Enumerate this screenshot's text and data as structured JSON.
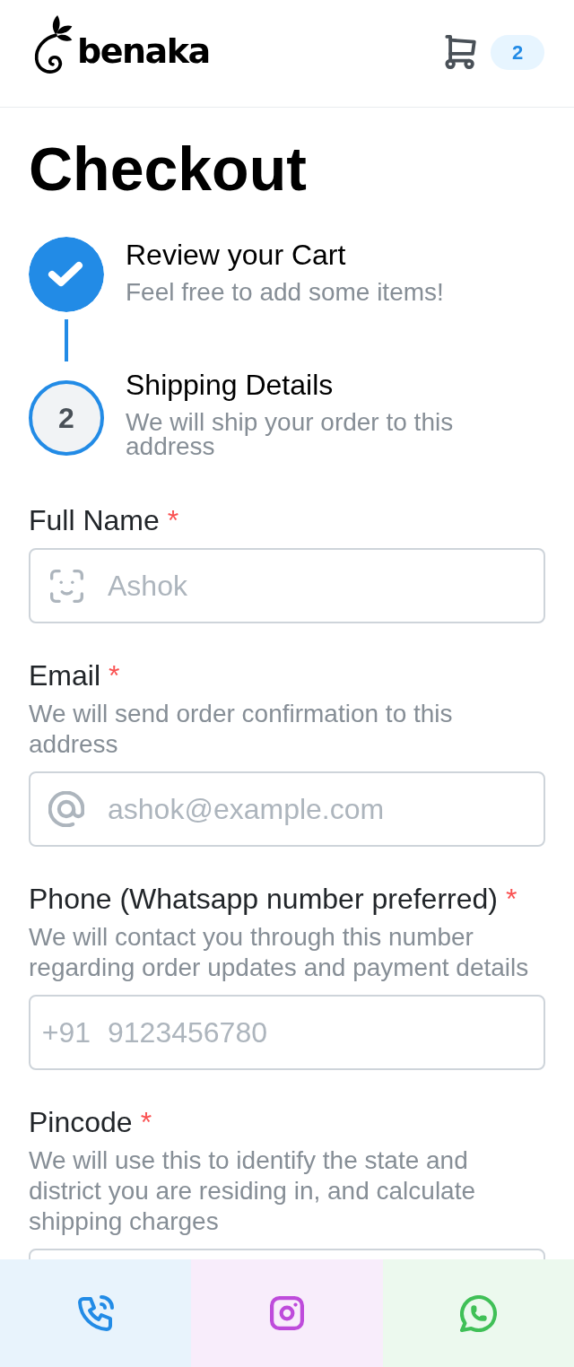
{
  "header": {
    "logo_text": "benaka",
    "cart_count": "2"
  },
  "page_title": "Checkout",
  "stepper": {
    "steps": [
      {
        "title": "Review your Cart",
        "description": "Feel free to add some items!",
        "completed": true,
        "active": false
      },
      {
        "number": "2",
        "title": "Shipping Details",
        "description": "We will ship your order to this address",
        "completed": false,
        "active": true
      }
    ]
  },
  "form": {
    "fields": [
      {
        "kind": "name",
        "label": "Full Name",
        "required_mark": "*",
        "placeholder": "Ashok"
      },
      {
        "kind": "email",
        "label": "Email",
        "required_mark": "*",
        "description": "We will send order confirmation to this address",
        "placeholder": "ashok@example.com"
      },
      {
        "kind": "phone",
        "label": "Phone (Whatsapp number preferred)",
        "required_mark": "*",
        "description": "We will contact you through this number regarding order updates and payment details",
        "prefix": "+91",
        "placeholder": "9123456780"
      },
      {
        "kind": "pincode",
        "label": "Pincode",
        "required_mark": "*",
        "description": "We will use this to identify the state and district you are residing in, and calculate shipping charges"
      }
    ]
  },
  "footer": {
    "buttons": [
      {
        "kind": "phone",
        "color": "#228be6"
      },
      {
        "kind": "instagram",
        "color": "#be4bdb"
      },
      {
        "kind": "whatsapp",
        "color": "#40c057"
      }
    ]
  }
}
